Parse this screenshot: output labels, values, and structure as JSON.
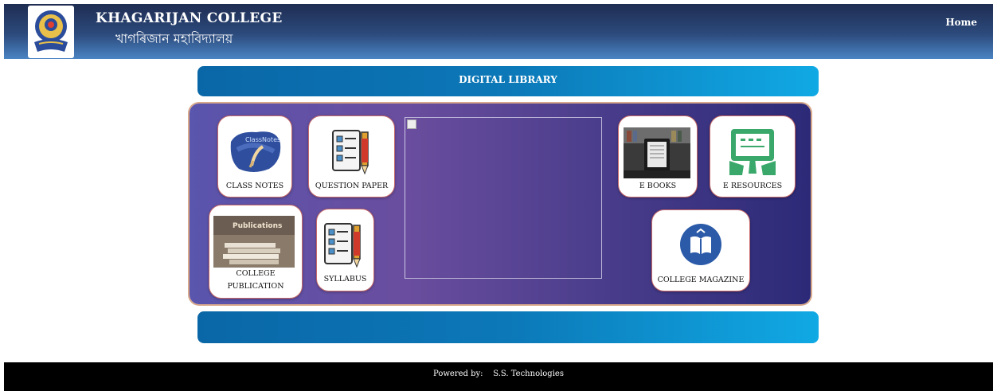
{
  "header": {
    "college_name_en": "KHAGARIJAN COLLEGE",
    "college_name_bn": "খাগৰিজান মহাবিদ্যালয়",
    "nav_home": "Home"
  },
  "library": {
    "title": "DIGITAL LIBRARY"
  },
  "tiles": {
    "class_notes": "CLASS NOTES",
    "class_notes_img_text": "ClassNotes",
    "question_paper": "QUESTION PAPER",
    "college_publication_1": "COLLEGE",
    "college_publication_2": "PUBLICATION",
    "publications_img_text": "Publications",
    "syllabus": "SYLLABUS",
    "e_books": "E BOOKS",
    "e_resources": "E RESOURCES",
    "college_magazine": "COLLEGE MAGAZINE"
  },
  "footer": {
    "powered_by": "Powered by:    S.S. Technologies"
  },
  "colors": {
    "header_dark": "#1f2d52",
    "bar_blue": "#0c78b8",
    "panel_purple": "#5a55ad",
    "tile_border": "#c86a6a"
  }
}
